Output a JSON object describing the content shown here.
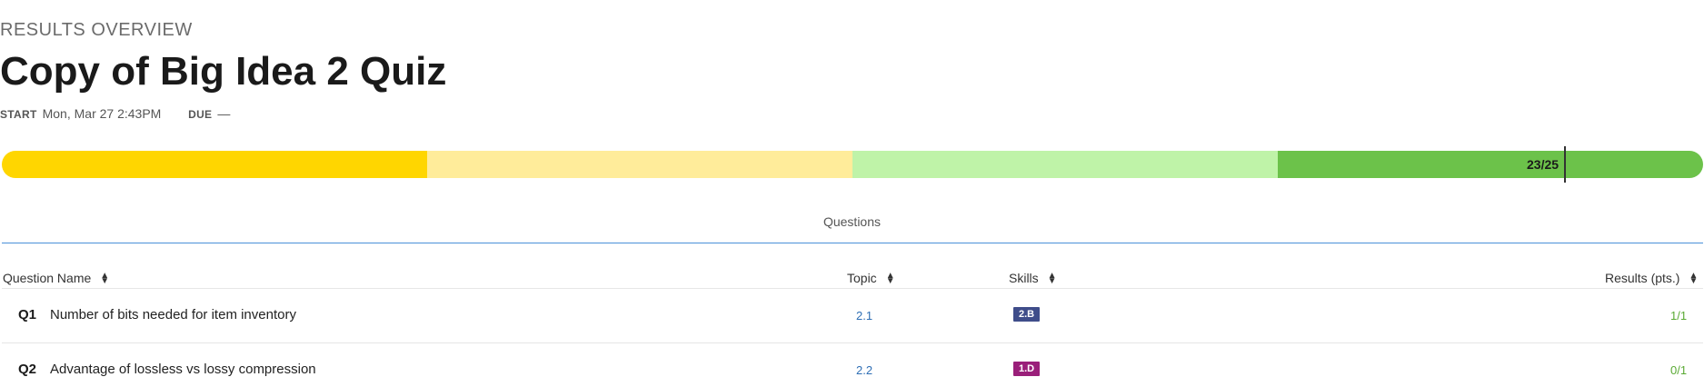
{
  "header": {
    "eyebrow": "RESULTS OVERVIEW",
    "title": "Copy of Big Idea 2 Quiz",
    "start_label": "START",
    "start_value": "Mon, Mar 27 2:43PM",
    "due_label": "DUE",
    "due_value": "—"
  },
  "progress": {
    "score_label": "23/25",
    "fraction": 0.92,
    "colors": [
      "#ffd600",
      "#ffec9a",
      "#bff3a8",
      "#6cc24a"
    ]
  },
  "tab": {
    "label": "Questions"
  },
  "table": {
    "columns": {
      "question_name": "Question Name",
      "topic": "Topic",
      "skills": "Skills",
      "results": "Results (pts.)"
    },
    "rows": [
      {
        "num": "Q1",
        "name": "Number of bits needed for item inventory",
        "topic": "2.1",
        "skill": "2.B",
        "skill_color": "#3f4d8a",
        "result": "1/1"
      },
      {
        "num": "Q2",
        "name": "Advantage of lossless vs lossy compression",
        "topic": "2.2",
        "skill": "1.D",
        "skill_color": "#9a1f7a",
        "result": "0/1"
      }
    ]
  },
  "icons": {
    "sort": "sort-updown-icon"
  }
}
